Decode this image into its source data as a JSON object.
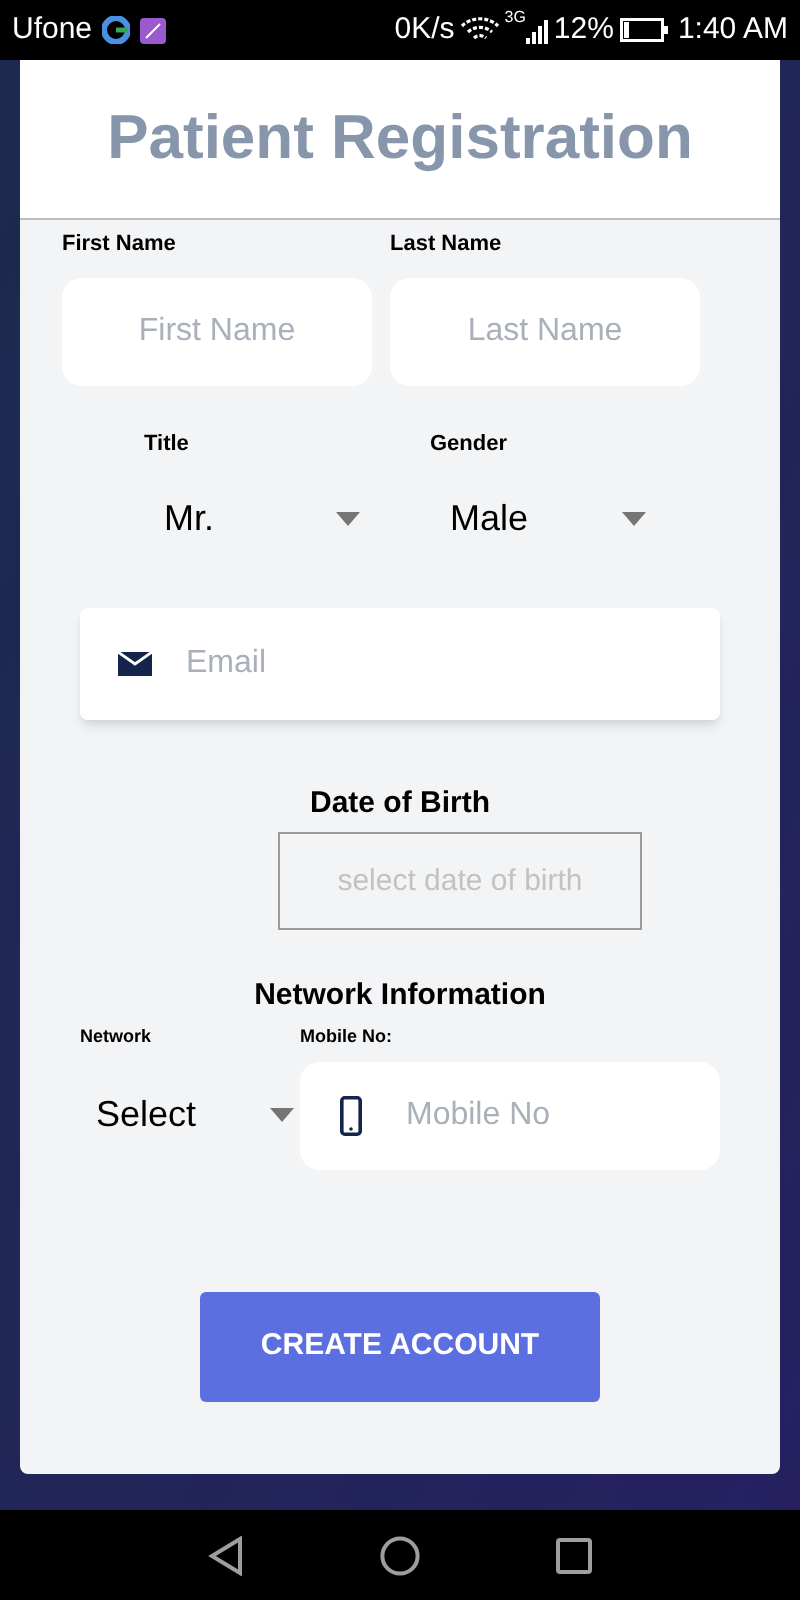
{
  "status_bar": {
    "carrier": "Ufone",
    "speed": "0K/s",
    "network_type": "3G",
    "battery": "12%",
    "time": "1:40 AM"
  },
  "title": "Patient Registration",
  "name_fields": [
    {
      "label": "First Name",
      "placeholder": "First Name"
    },
    {
      "label": "Last Name",
      "placeholder": "Last Name"
    }
  ],
  "dropdowns": [
    {
      "label": "Title",
      "value": "Mr."
    },
    {
      "label": "Gender",
      "value": "Male"
    }
  ],
  "email": {
    "placeholder": "Email"
  },
  "date_of_birth": {
    "label": "Date of Birth",
    "placeholder": "select date of birth"
  },
  "network_info": {
    "heading": "Network Information",
    "network_label": "Network",
    "network_value": "Select",
    "mobile_label": "Mobile No:",
    "mobile_placeholder": "Mobile No"
  },
  "create_button": "CREATE ACCOUNT"
}
